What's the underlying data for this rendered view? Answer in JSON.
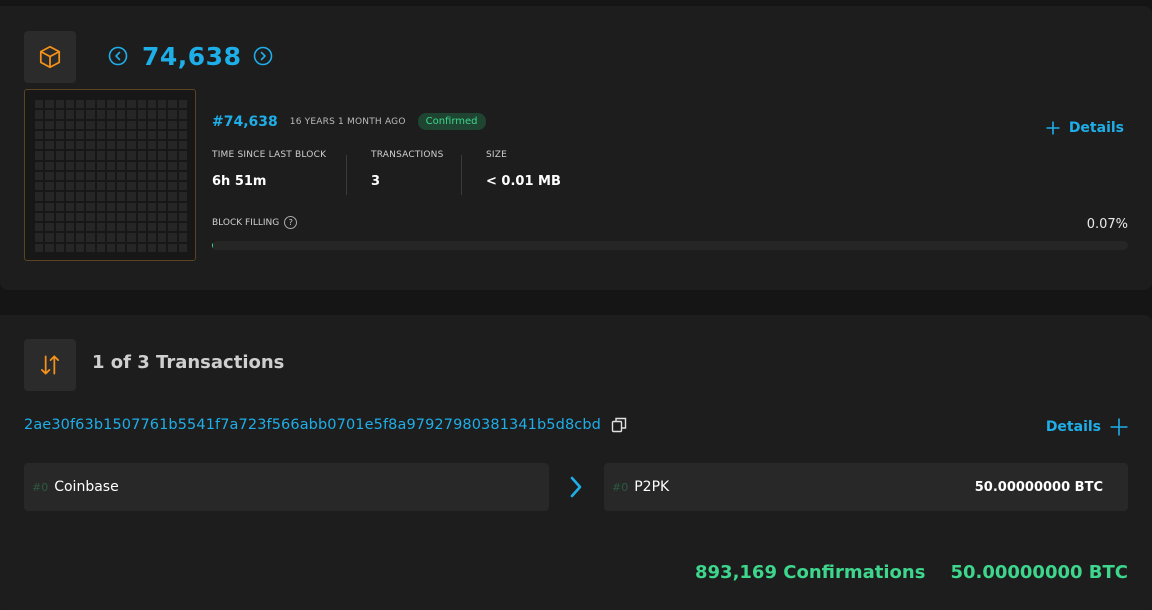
{
  "block": {
    "height_display": "74,638",
    "number_label": "#74,638",
    "age": "16 YEARS 1 MONTH AGO",
    "status": "Confirmed",
    "details_label": "Details",
    "stats": [
      {
        "label": "TIME SINCE LAST BLOCK",
        "value": "6h 51m"
      },
      {
        "label": "TRANSACTIONS",
        "value": "3"
      },
      {
        "label": "SIZE",
        "value": "< 0.01 MB"
      }
    ],
    "filling_label": "BLOCK FILLING",
    "filling_help": "?",
    "filling_percent_text": "0.07%",
    "filling_fraction": 0.0007
  },
  "transactions": {
    "title": "1 of 3 Transactions",
    "txid": "2ae30f63b1507761b5541f7a723f566abb0701e5f8a97927980381341b5d8cbd",
    "details_label": "Details",
    "input": {
      "index": "#0",
      "name": "Coinbase"
    },
    "output": {
      "index": "#0",
      "name": "P2PK",
      "amount": "50.00000000 BTC"
    },
    "confirmations": "893,169 Confirmations",
    "total": "50.00000000 BTC"
  },
  "colors": {
    "accent_blue": "#1eaee8",
    "accent_orange": "#f7931a",
    "success_green": "#3dd68c"
  },
  "icons": {
    "block": "cube-icon",
    "prev": "chevron-left-circle-icon",
    "next": "chevron-right-circle-icon",
    "transactions": "swap-vertical-icon",
    "copy": "copy-icon",
    "expand": "plus-icon",
    "flow": "chevron-right-icon"
  }
}
